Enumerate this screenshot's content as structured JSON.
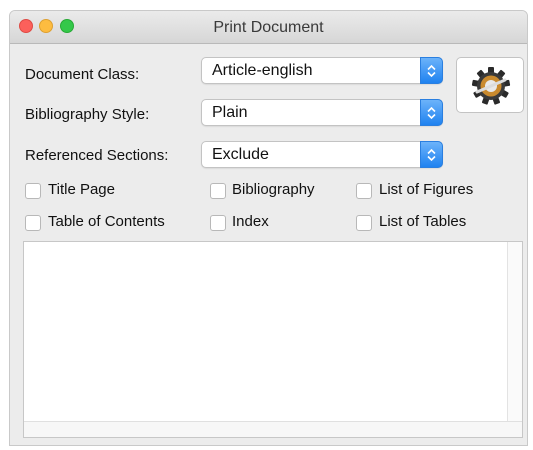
{
  "window": {
    "title": "Print Document"
  },
  "form": {
    "document_class": {
      "label": "Document Class:",
      "value": "Article-english"
    },
    "bibliography_style": {
      "label": "Bibliography Style:",
      "value": "Plain"
    },
    "referenced_sections": {
      "label": "Referenced Sections:",
      "value": "Exclude"
    }
  },
  "settings_button": {
    "icon": "gear-icon"
  },
  "checkboxes": [
    {
      "label": "Title Page",
      "checked": false
    },
    {
      "label": "Bibliography",
      "checked": false
    },
    {
      "label": "List of Figures",
      "checked": false
    },
    {
      "label": "Table of Contents",
      "checked": false
    },
    {
      "label": "Index",
      "checked": false
    },
    {
      "label": "List of Tables",
      "checked": false
    }
  ],
  "output": {
    "text": ""
  },
  "colors": {
    "accent": "#1f82f0",
    "window_bg": "#ececec"
  }
}
